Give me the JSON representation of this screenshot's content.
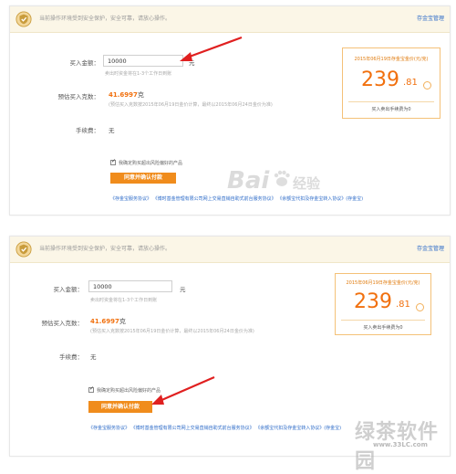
{
  "notice": {
    "text": "当前操作环境受到安全保护，安全可靠，请放心操作。",
    "link": "存金宝管理"
  },
  "form": {
    "buy_amount_label": "买入金额：",
    "buy_amount_value": "10000",
    "unit_yuan": "元",
    "buy_hint": "卖出时资金将在1-3个工作日到账",
    "estimate_label": "预估买入克数：",
    "estimate_value": "41.6997",
    "unit_gram": "克",
    "estimate_note": "(预估买入克数按2015年06月19日金价计算，最终以2015年06月24日金价为准)",
    "fee_label": "手续费：",
    "fee_value": "无",
    "agree_text": "我确定购买超出风险偏好的产品",
    "submit_label": "同意并确认付款"
  },
  "price": {
    "title": "2015年06月19日存金宝金价(元/克)",
    "int_part": "239",
    "dec_part": ".81",
    "footer": "买入卖出手续费为0"
  },
  "links": [
    "《存金宝服务协议》",
    "《博时基金管理有限公司网上交易直销自助式前台服务协议》",
    "《余额宝代扣及存金宝转入协议》(存金宝)"
  ],
  "watermarks": {
    "baidu": "Bai",
    "baidu_jingyan": "经验",
    "site_name": "绿茶软件园",
    "site_url": "www.33LC.com"
  },
  "colors": {
    "accent": "#f1700e",
    "button": "#f08c1c",
    "link": "#2d6bc8",
    "notice_bg": "#fbf6e7"
  }
}
